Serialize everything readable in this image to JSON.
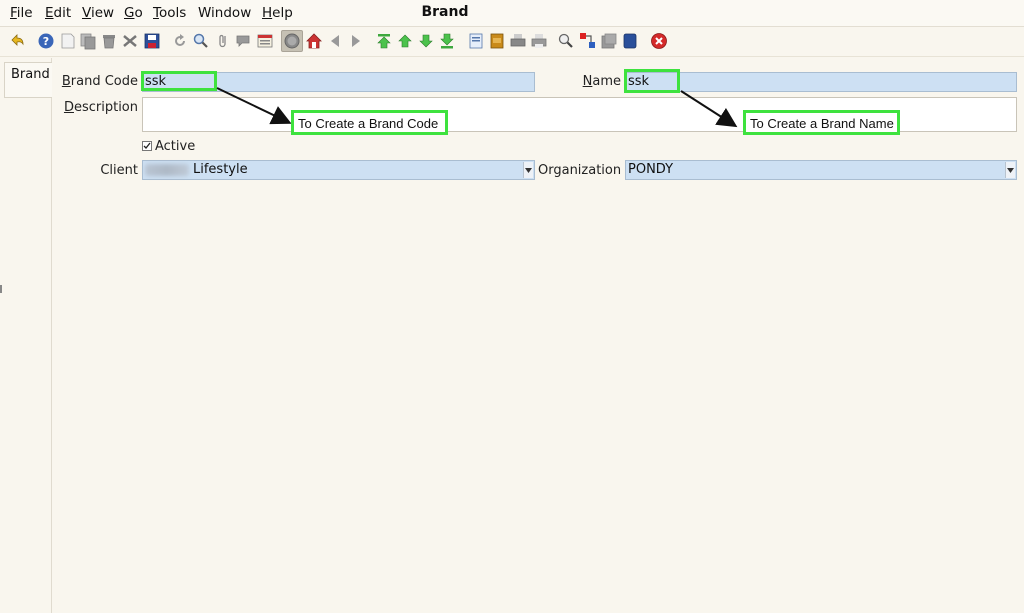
{
  "window": {
    "title": "Brand"
  },
  "menu": [
    {
      "pre": "",
      "ul": "F",
      "post": "ile"
    },
    {
      "pre": "",
      "ul": "E",
      "post": "dit"
    },
    {
      "pre": "",
      "ul": "V",
      "post": "iew"
    },
    {
      "pre": "",
      "ul": "G",
      "post": "o"
    },
    {
      "pre": "",
      "ul": "T",
      "post": "ools"
    },
    {
      "pre": "Window",
      "ul": "",
      "post": ""
    },
    {
      "pre": "",
      "ul": "H",
      "post": "elp"
    }
  ],
  "toolbar_icons": [
    "undo-icon",
    "help-icon",
    "new-record-icon",
    "copy-record-icon",
    "delete-icon",
    "delete-selection-icon",
    "save-icon",
    "refresh-icon",
    "find-icon",
    "attachment-icon",
    "chat-icon",
    "multi-view-icon",
    "history-icon",
    "home-icon",
    "prev-icon",
    "next-icon",
    "first-record-icon",
    "previous-record-icon",
    "next-record-icon",
    "last-record-icon",
    "report-icon",
    "archive-icon",
    "print-preview-icon",
    "print-icon",
    "zoom-across-icon",
    "workflow-icon",
    "product-info-icon",
    "request-icon",
    "exit-icon"
  ],
  "tabs": [
    {
      "label": "Brand"
    }
  ],
  "form": {
    "brand_code": {
      "label_ul": "B",
      "label_rest": "rand Code",
      "value": "ssk"
    },
    "name": {
      "label_ul": "N",
      "label_rest": "ame",
      "value": "ssk"
    },
    "description": {
      "label_ul": "D",
      "label_rest": "escription",
      "value": ""
    },
    "active": {
      "label": "Active",
      "checked": true
    },
    "client": {
      "label": "Client",
      "value": "Lifestyle"
    },
    "organization": {
      "label": "Organization",
      "value": "PONDY"
    }
  },
  "annotations": {
    "brand_code_note": "To Create a Brand Code",
    "name_note": "To Create a Brand Name",
    "highlight_color": "#3ee23e"
  },
  "colors": {
    "field_bg": "#cde0f3",
    "window_bg": "#f9f6ee"
  }
}
